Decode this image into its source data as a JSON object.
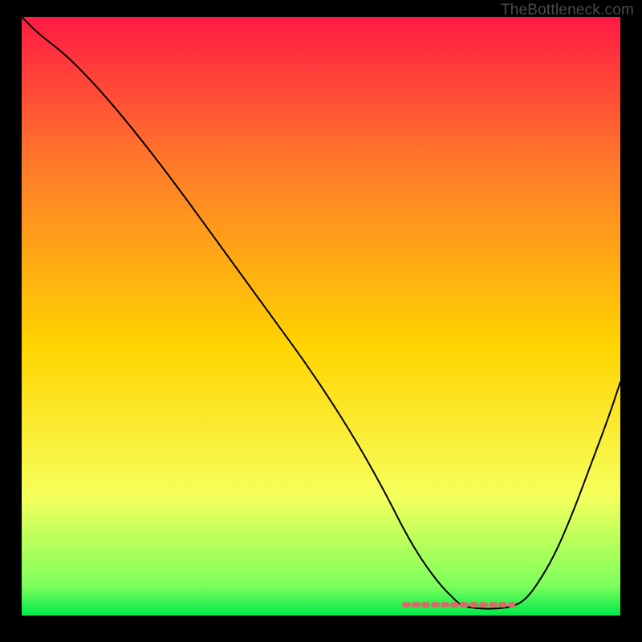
{
  "watermark": "TheBottleneck.com",
  "chart_data": {
    "type": "line",
    "title": "",
    "xlabel": "",
    "ylabel": "",
    "xlim": [
      0,
      100
    ],
    "ylim": [
      0,
      100
    ],
    "gradient_background": {
      "top_color": "#ff1a44",
      "mid_color": "#ffd400",
      "bottom_color": "#00e84a",
      "stops": [
        {
          "offset": 0,
          "color": "#ff1a44"
        },
        {
          "offset": 25,
          "color": "#ff7b2a"
        },
        {
          "offset": 55,
          "color": "#ffd400"
        },
        {
          "offset": 80,
          "color": "#f6ff5c"
        },
        {
          "offset": 95,
          "color": "#7dff5c"
        },
        {
          "offset": 100,
          "color": "#00e84a"
        }
      ]
    },
    "series": [
      {
        "name": "bottleneck-curve",
        "stroke": "#000000",
        "stroke_width": 2,
        "x": [
          0,
          3,
          7,
          12,
          18,
          25,
          33,
          41,
          49,
          56,
          61,
          64,
          67,
          70,
          72,
          73,
          74,
          76,
          78,
          80,
          82,
          84,
          86,
          89,
          92,
          95,
          98,
          100
        ],
        "values": [
          100,
          97,
          94,
          89,
          82,
          73,
          62,
          51,
          40,
          29,
          20,
          14,
          9,
          5,
          3,
          2,
          1.5,
          1.2,
          1.1,
          1.2,
          1.5,
          2.5,
          5,
          10,
          17,
          25,
          33,
          39
        ]
      },
      {
        "name": "optimal-range-marker",
        "stroke": "#d96a6a",
        "stroke_width": 7,
        "type": "marker-band",
        "x": [
          64,
          67,
          70,
          72,
          74,
          76,
          78,
          80,
          82
        ],
        "values": [
          1.8,
          1.8,
          1.8,
          1.8,
          1.8,
          1.8,
          1.8,
          1.8,
          1.8
        ]
      }
    ]
  }
}
